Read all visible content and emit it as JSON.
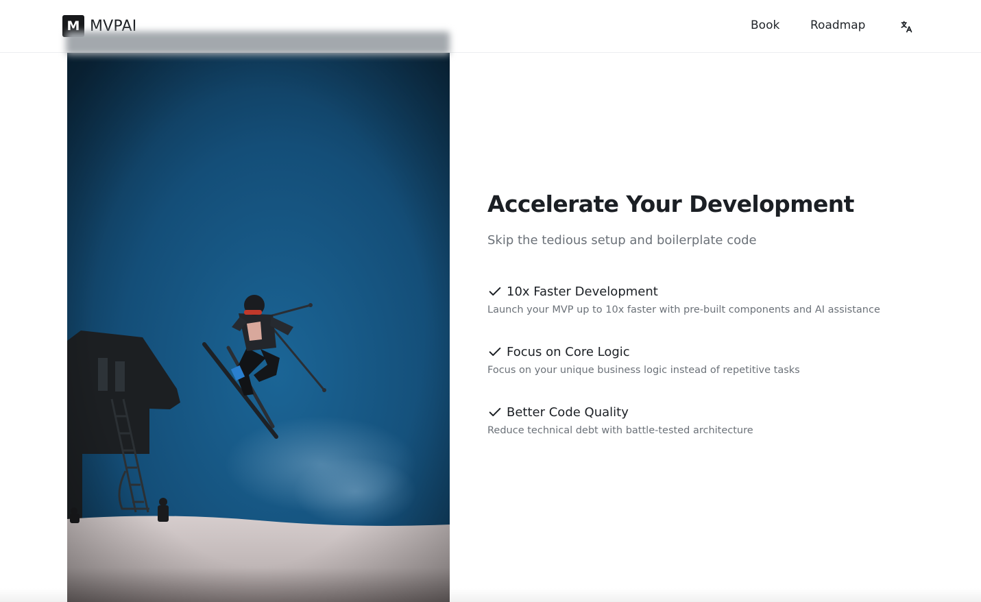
{
  "header": {
    "logo_letter": "M",
    "logo_text": "MVPAI",
    "nav": [
      {
        "label": "Book"
      },
      {
        "label": "Roadmap"
      }
    ],
    "language_icon": "translate-icon"
  },
  "hero": {
    "image_icon": "skier-jump-photo"
  },
  "main": {
    "headline": "Accelerate Your Development",
    "subheadline": "Skip the tedious setup and boilerplate code",
    "features": [
      {
        "title": "10x Faster Development",
        "description": "Launch your MVP up to 10x faster with pre-built components and AI assistance"
      },
      {
        "title": "Focus on Core Logic",
        "description": "Focus on your unique business logic instead of repetitive tasks"
      },
      {
        "title": "Better Code Quality",
        "description": "Reduce technical debt with battle-tested architecture"
      }
    ],
    "feature_icon": "check-icon"
  },
  "colors": {
    "text_primary": "#1b1f24",
    "text_secondary": "#6b7178",
    "sky": "#1a5f8f",
    "snow": "#c9c0c0"
  }
}
